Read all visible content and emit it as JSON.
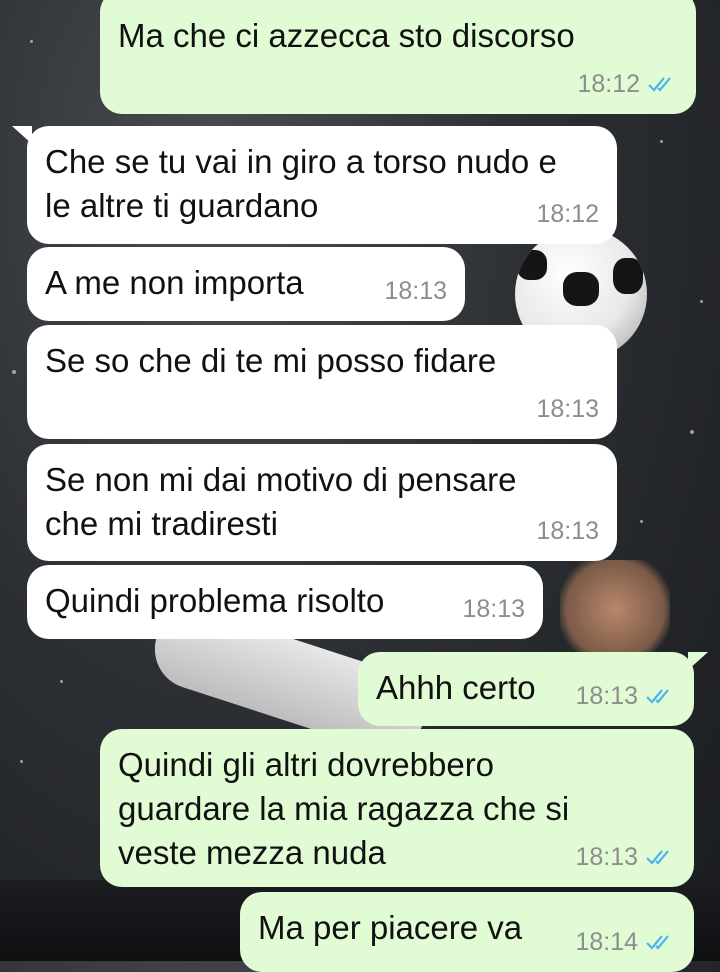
{
  "messages": [
    {
      "dir": "out",
      "text": "Ma che ci azzecca sto discorso",
      "time": "18:12",
      "read": true
    },
    {
      "dir": "in",
      "text": "Che se tu vai in giro a torso nudo e\nle altre ti guardano",
      "time": "18:12"
    },
    {
      "dir": "in",
      "text": "A me non importa",
      "time": "18:13"
    },
    {
      "dir": "in",
      "text": "Se so che di te mi posso fidare",
      "time": "18:13"
    },
    {
      "dir": "in",
      "text": "Se non mi dai motivo di pensare\nche mi tradiresti",
      "time": "18:13"
    },
    {
      "dir": "in",
      "text": "Quindi problema risolto",
      "time": "18:13"
    },
    {
      "dir": "out",
      "text": "Ahhh certo",
      "time": "18:13",
      "read": true
    },
    {
      "dir": "out",
      "text": "Quindi gli altri dovrebbero\nguardare la mia ragazza che si\nveste mezza nuda",
      "time": "18:13",
      "read": true
    },
    {
      "dir": "out",
      "text": "Ma per piacere va",
      "time": "18:14",
      "read": true
    }
  ],
  "colors": {
    "incoming": "#ffffff",
    "outgoing": "#e1fcd4",
    "read_ticks": "#4fb6ec",
    "time": "#8d8d8d"
  },
  "icons": {
    "read_receipt": "double-check-icon"
  }
}
